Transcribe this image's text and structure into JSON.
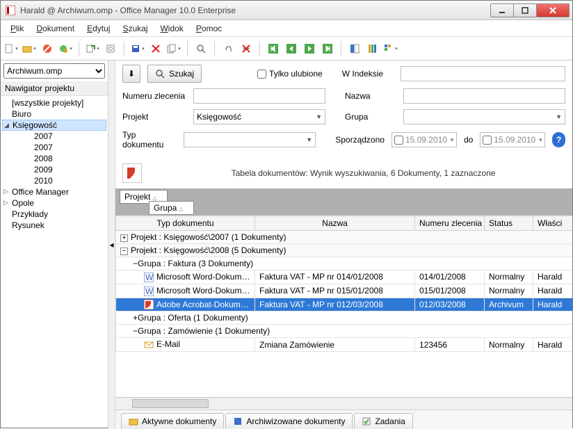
{
  "window": {
    "title": "Harald @ Archiwum.omp - Office Manager 10.0 Enterprise"
  },
  "menu": {
    "plik": "Plik",
    "dokument": "Dokument",
    "edytuj": "Edytuj",
    "szukaj": "Szukaj",
    "widok": "Widok",
    "pomoc": "Pomoc"
  },
  "sidebar": {
    "db_file": "Archiwum.omp",
    "nav_header": "Nawigator projektu",
    "nodes": {
      "all": "[wszystkie projekty]",
      "biuro": "Biuro",
      "ksiegowosc": "Księgowość",
      "y2007": "2007",
      "y2007b": "2007",
      "y2008": "2008",
      "y2009": "2009",
      "y2010": "2010",
      "office_manager": "Office Manager",
      "opole": "Opole",
      "przyklady": "Przykłady",
      "rysunek": "Rysunek"
    }
  },
  "search": {
    "szukaj_btn": "Szukaj",
    "ulubione": "Tylko ulubione",
    "windeksie_lbl": "W Indeksie",
    "numeru_lbl": "Numeru zlecenia",
    "nazwa_lbl": "Nazwa",
    "projekt_lbl": "Projekt",
    "projekt_val": "Księgowość",
    "grupa_lbl": "Grupa",
    "typ_lbl": "Typ dokumentu",
    "sporz_lbl": "Sporządzono",
    "date_from": "15.09.2010",
    "do_lbl": "do",
    "date_to": "15.09.2010"
  },
  "results": {
    "summary": "Tabela dokumentów: Wynik wyszukiwania, 6 Dokumenty, 1 zaznaczone",
    "group1": "Projekt",
    "group2": "Grupa",
    "cols": {
      "typ": "Typ dokumentu",
      "nazwa": "Nazwa",
      "numeru": "Numeru zlecenia",
      "status": "Status",
      "wlasc": "Właści"
    },
    "g2007": "Projekt : Księgowość\\2007 (1 Dokumenty)",
    "g2008": "Projekt : Księgowość\\2008 (5 Dokumenty)",
    "sg_faktura": "Grupa : Faktura (3 Dokumenty)",
    "sg_oferta": "Grupa : Oferta (1 Dokumenty)",
    "sg_zamow": "Grupa : Zamówienie (1 Dokumenty)",
    "rows": [
      {
        "typ": "Microsoft Word-Dokument",
        "nazwa": "Faktura VAT - MP nr 014/01/2008",
        "num": "014/01/2008",
        "status": "Normalny",
        "owner": "Harald"
      },
      {
        "typ": "Microsoft Word-Dokument",
        "nazwa": "Faktura VAT - MP nr 015/01/2008",
        "num": "015/01/2008",
        "status": "Normalny",
        "owner": "Harald"
      },
      {
        "typ": "Adobe Acrobat-Dokument",
        "nazwa": "Faktura VAT - MP nr 012/03/2008",
        "num": "012/03/2008",
        "status": "Archivum",
        "owner": "Harald"
      },
      {
        "typ": "E-Mail",
        "nazwa": "Zmiana Zamówienie",
        "num": "123456",
        "status": "Normalny",
        "owner": "Harald"
      }
    ]
  },
  "tabs": {
    "aktywne": "Aktywne dokumenty",
    "archiwizowane": "Archiwizowane dokumenty",
    "zadania": "Zadania"
  }
}
